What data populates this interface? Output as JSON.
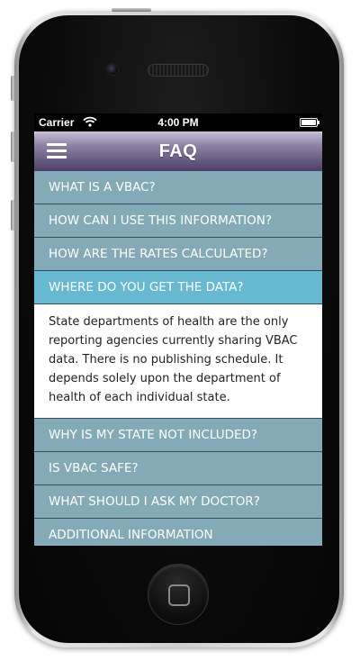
{
  "status_bar": {
    "carrier": "Carrier",
    "time": "4:00 PM"
  },
  "nav": {
    "title": "FAQ",
    "menu_icon": "hamburger-menu-icon"
  },
  "faq": {
    "items": [
      {
        "question": "WHAT IS A VBAC?"
      },
      {
        "question": "HOW CAN I USE THIS INFORMATION?"
      },
      {
        "question": "HOW ARE THE RATES CALCULATED?"
      },
      {
        "question": "WHERE DO YOU GET THE DATA?",
        "expanded": true,
        "answer": "State departments of health are the only reporting agencies currently sharing VBAC data. There is no publishing schedule. It depends solely upon the department of health of each individual state."
      },
      {
        "question": "WHY IS MY STATE NOT INCLUDED?"
      },
      {
        "question": "IS VBAC SAFE?"
      },
      {
        "question": "WHAT SHOULD I ASK MY DOCTOR?"
      },
      {
        "question": "ADDITIONAL INFORMATION"
      }
    ]
  },
  "colors": {
    "item_bg": "#83aab6",
    "active_item_bg": "#66b9d0",
    "nav_dark": "#4b3f67",
    "nav_light": "#c7c0d6"
  }
}
